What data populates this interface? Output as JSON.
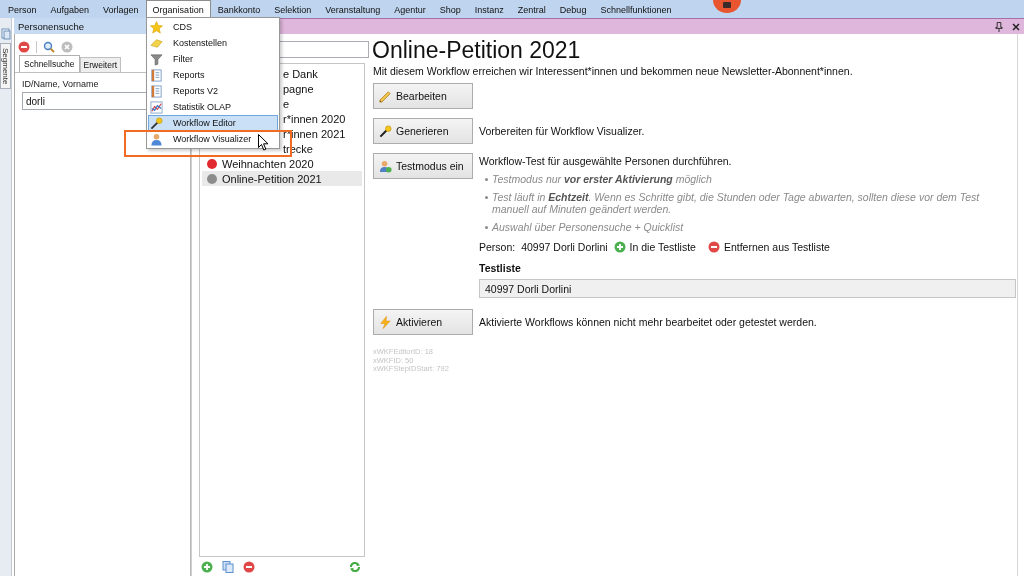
{
  "menu_bar": {
    "items": [
      {
        "label": "Person",
        "selected": false
      },
      {
        "label": "Aufgaben",
        "selected": false
      },
      {
        "label": "Vorlagen",
        "selected": false
      },
      {
        "label": "Organisation",
        "selected": true
      },
      {
        "label": "Bankkonto",
        "selected": false
      },
      {
        "label": "Selektion",
        "selected": false
      },
      {
        "label": "Veranstaltung",
        "selected": false
      },
      {
        "label": "Agentur",
        "selected": false
      },
      {
        "label": "Shop",
        "selected": false
      },
      {
        "label": "Instanz",
        "selected": false
      },
      {
        "label": "Zentral",
        "selected": false
      },
      {
        "label": "Debug",
        "selected": false
      },
      {
        "label": "Schnellfunktionen",
        "selected": false
      }
    ]
  },
  "organisation_menu": {
    "items": [
      {
        "label": "CDS",
        "selected": false
      },
      {
        "label": "Kostenstellen",
        "selected": false
      },
      {
        "label": "Filter",
        "selected": false
      },
      {
        "label": "Reports",
        "selected": false
      },
      {
        "label": "Reports V2",
        "selected": false
      },
      {
        "label": "Statistik OLAP",
        "selected": false
      },
      {
        "label": "Workflow Editor",
        "selected": true
      },
      {
        "label": "Workflow Visualizer",
        "selected": false
      }
    ]
  },
  "side_tab": {
    "label": "Segmente"
  },
  "person_search": {
    "title": "Personensuche",
    "tabs": [
      {
        "label": "Schnellsuche",
        "selected": true
      },
      {
        "label": "Erweitert",
        "selected": false
      }
    ],
    "field": {
      "label": "ID/Name, Vorname",
      "value": "dorli"
    }
  },
  "workflow_list": {
    "items": [
      {
        "label": "e Dank",
        "kind": "covered",
        "selected": false
      },
      {
        "label": "pagne",
        "kind": "covered",
        "selected": false
      },
      {
        "label": "e",
        "kind": "covered",
        "selected": false
      },
      {
        "label": "r*innen 2020",
        "kind": "covered",
        "selected": false
      },
      {
        "label": "r*innen 2021",
        "kind": "covered",
        "selected": false
      },
      {
        "label": "trecke",
        "kind": "covered",
        "selected": false
      },
      {
        "label": "Weihnachten 2020",
        "kind": "status",
        "color": "#e02a2f",
        "selected": false
      },
      {
        "label": "Online-Petition 2021",
        "kind": "status",
        "color": "#8c8c8c",
        "selected": true
      }
    ]
  },
  "workflow": {
    "title": "Online-Petition 2021",
    "description": "Mit diesem Workflow erreichen wir Interessent*innen und bekommen neue Newsletter-Abonnent*innen.",
    "edit": {
      "button": "Bearbeiten"
    },
    "generate": {
      "button": "Generieren",
      "note": "Vorbereiten für Workflow Visualizer."
    },
    "test": {
      "button": "Testmodus ein",
      "note": "Workflow-Test für ausgewählte Personen durchführen.",
      "hints": [
        "Testmodus nur **vor erster Aktivierung** möglich",
        "Test läuft in **Echtzeit**. Wenn es Schritte gibt, die Stunden oder Tage abwarten, sollten diese vor dem Test manuell auf Minuten geändert werden.",
        "Auswahl über Personensuche + Quicklist"
      ],
      "person_label": "Person:",
      "person": "40997 Dorli Dorlini",
      "add_action": "In die Testliste",
      "remove_action": "Entfernen aus Testliste",
      "list_title": "Testliste",
      "list_items": [
        "40997 Dorli Dorlini"
      ]
    },
    "activate": {
      "button": "Aktivieren",
      "note": "Aktivierte Workflows können nicht mehr bearbeitet oder getestet werden."
    },
    "debug_info": [
      "xWKFEditorID: 18",
      "xWKFID: 50",
      "xWKFStepIDStart: 792"
    ]
  }
}
